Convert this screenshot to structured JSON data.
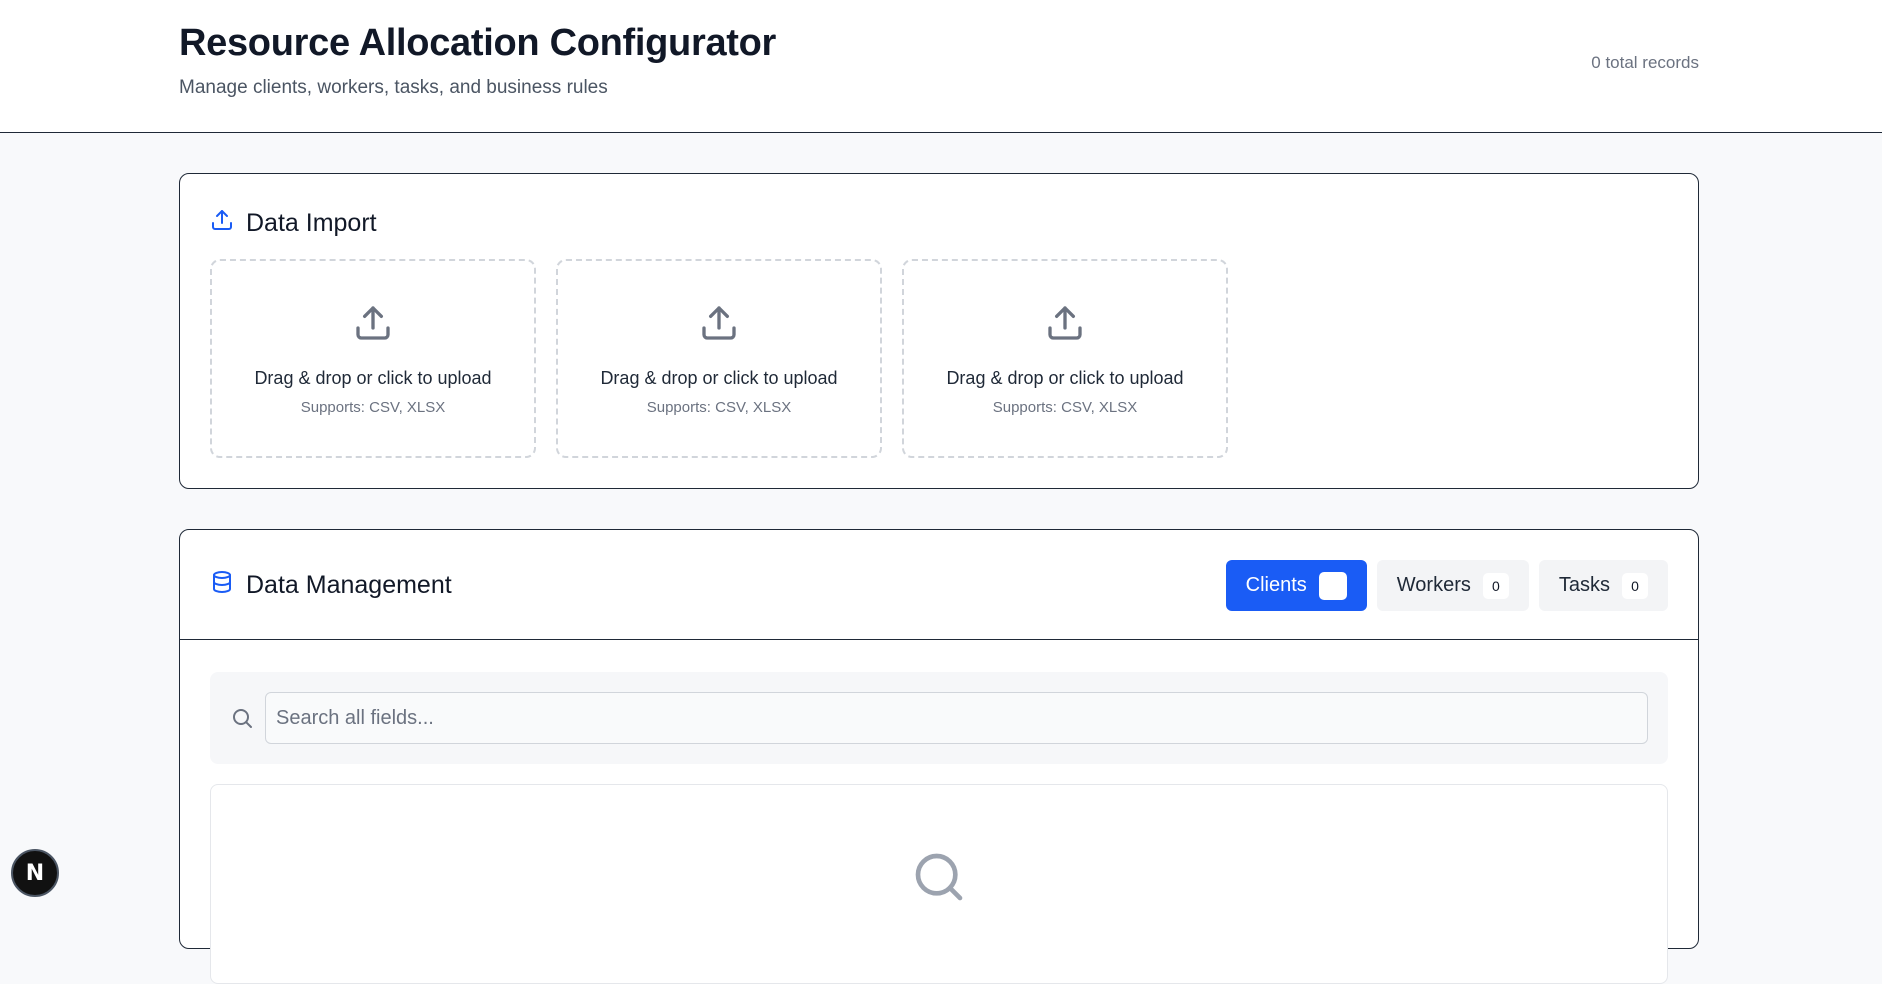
{
  "header": {
    "title": "Resource Allocation Configurator",
    "subtitle": "Manage clients, workers, tasks, and business rules",
    "records": "0 total records"
  },
  "import": {
    "title": "Data Import",
    "icon": "upload-icon",
    "dropzones": [
      {
        "label": "Drag & drop or click to upload",
        "hint": "Supports: CSV, XLSX"
      },
      {
        "label": "Drag & drop or click to upload",
        "hint": "Supports: CSV, XLSX"
      },
      {
        "label": "Drag & drop or click to upload",
        "hint": "Supports: CSV, XLSX"
      }
    ]
  },
  "manage": {
    "title": "Data Management",
    "icon": "database-icon",
    "tabs": [
      {
        "label": "Clients",
        "count": "",
        "active": true
      },
      {
        "label": "Workers",
        "count": "0",
        "active": false
      },
      {
        "label": "Tasks",
        "count": "0",
        "active": false
      }
    ],
    "search": {
      "placeholder": "Search all fields...",
      "value": ""
    }
  },
  "devtools": {
    "label": "N"
  },
  "colors": {
    "accent": "#1a5cf5",
    "border": "#1f2937",
    "muted": "#6b7280"
  }
}
